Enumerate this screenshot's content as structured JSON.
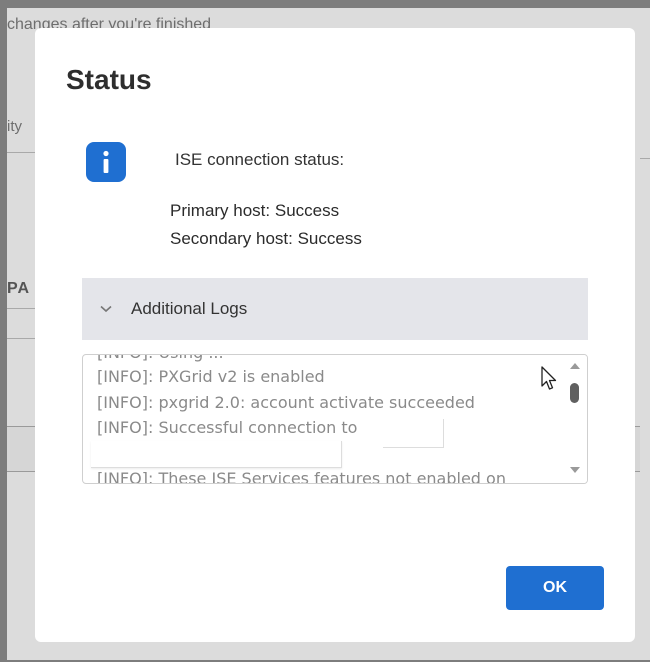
{
  "background": {
    "top_text": "changes after you're finished",
    "left_text_1": "ity",
    "left_text_2": "PA"
  },
  "dialog": {
    "title": "Status",
    "icon": "info-icon",
    "status_heading": "ISE connection status:",
    "primary_host": "Primary host: Success",
    "secondary_host": "Secondary host: Success",
    "logs_section_label": "Additional Logs",
    "logs": [
      "[INFO]: Using ...",
      "[INFO]: PXGrid v2 is enabled",
      "[INFO]: pxgrid 2.0: account activate succeeded",
      "[INFO]: Successful connection to",
      "[INFO]: These ISE Services features not enabled on"
    ],
    "ok_label": "OK"
  },
  "colors": {
    "accent": "#1f6fd1",
    "logs_header_bg": "#e4e5ea",
    "overlay": "#7d7d7d"
  }
}
